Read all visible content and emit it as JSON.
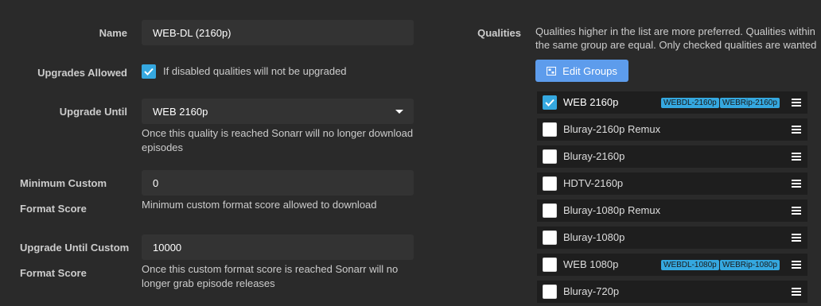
{
  "form": {
    "name": {
      "label": "Name",
      "value": "WEB-DL (2160p)"
    },
    "upgrades_allowed": {
      "label": "Upgrades Allowed",
      "checked": true,
      "help": "If disabled qualities will not be upgraded"
    },
    "upgrade_until": {
      "label": "Upgrade Until",
      "selected": "WEB 2160p",
      "help_line1": "Once this quality is reached Sonarr will no longer download",
      "help_line2": "episodes"
    },
    "min_custom": {
      "label_line1": "Minimum Custom",
      "label_line2": "Format Score",
      "value": "0",
      "help": "Minimum custom format score allowed to download"
    },
    "upgrade_until_custom": {
      "label_line1": "Upgrade Until Custom",
      "label_line2": "Format Score",
      "value": "10000",
      "help_line1": "Once this custom format score is reached Sonarr will no",
      "help_line2": "longer grab episode releases"
    }
  },
  "qualities": {
    "label": "Qualities",
    "help_line1": "Qualities higher in the list are more preferred. Qualities within",
    "help_line2": "the same group are equal. Only checked qualities are wanted",
    "edit_groups_label": "Edit Groups",
    "items": [
      {
        "name": "WEB 2160p",
        "checked": true,
        "tags": [
          "WEBDL-2160p",
          "WEBRip-2160p"
        ]
      },
      {
        "name": "Bluray-2160p Remux",
        "checked": false,
        "tags": []
      },
      {
        "name": "Bluray-2160p",
        "checked": false,
        "tags": []
      },
      {
        "name": "HDTV-2160p",
        "checked": false,
        "tags": []
      },
      {
        "name": "Bluray-1080p Remux",
        "checked": false,
        "tags": []
      },
      {
        "name": "Bluray-1080p",
        "checked": false,
        "tags": []
      },
      {
        "name": "WEB 1080p",
        "checked": false,
        "tags": [
          "WEBDL-1080p",
          "WEBRip-1080p"
        ]
      },
      {
        "name": "Bluray-720p",
        "checked": false,
        "tags": []
      }
    ]
  },
  "colors": {
    "accent": "#35a8e0",
    "button": "#5d9cec",
    "background": "#2a2a2a",
    "row": "#1e1e1e",
    "input": "#333333"
  },
  "icons": {
    "checkbox_checked": "check-icon",
    "edit_groups": "groups-icon",
    "drag": "drag-handle-icon",
    "select": "caret-down-icon"
  }
}
